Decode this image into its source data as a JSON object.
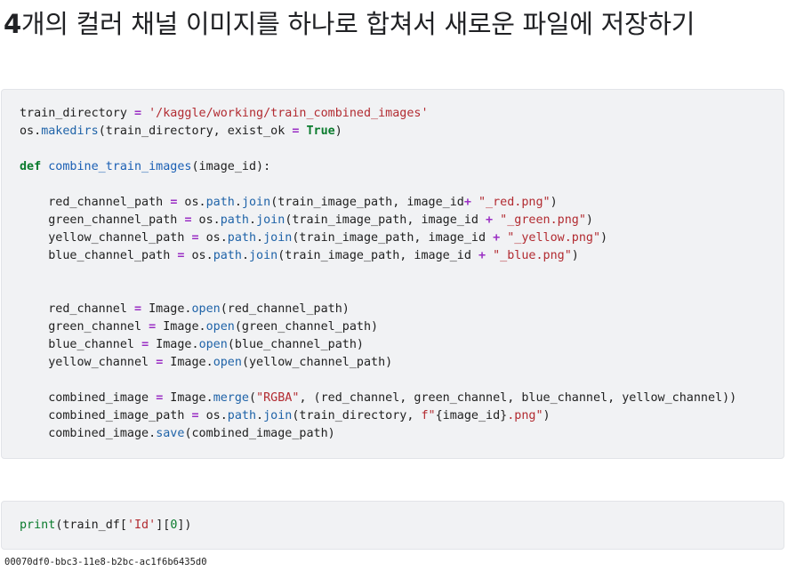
{
  "heading": {
    "number": "4",
    "text": "개의 컬러 채널 이미지를 하나로 합쳐서 새로운 파일에 저장하기"
  },
  "cell_1": {
    "lines": [
      "train_directory = '/kaggle/working/train_combined_images'",
      "os.makedirs(train_directory, exist_ok = True)",
      "",
      "def combine_train_images(image_id):",
      "",
      "    red_channel_path = os.path.join(train_image_path, image_id+ \"_red.png\")",
      "    green_channel_path = os.path.join(train_image_path, image_id + \"_green.png\")",
      "    yellow_channel_path = os.path.join(train_image_path, image_id + \"_yellow.png\")",
      "    blue_channel_path = os.path.join(train_image_path, image_id + \"_blue.png\")",
      "",
      "",
      "    red_channel = Image.open(red_channel_path)",
      "    green_channel = Image.open(green_channel_path)",
      "    blue_channel = Image.open(blue_channel_path)",
      "    yellow_channel = Image.open(yellow_channel_path)",
      "",
      "    combined_image = Image.merge(\"RGBA\", (red_channel, green_channel, blue_channel, yellow_channel))",
      "    combined_image_path = os.path.join(train_directory, f\"{image_id}.png\")",
      "    combined_image.save(combined_image_path)"
    ]
  },
  "cell_2": {
    "lines": [
      "print(train_df['Id'][0])"
    ]
  },
  "output": {
    "text": "00070df0-bbc3-11e8-b2bc-ac1f6b6435d0"
  },
  "colors": {
    "cell_background": "#f1f2f4",
    "string": "#b22b31",
    "keyword": "#0a7b2d",
    "function": "#1a5fb4",
    "operator": "#9a2fc4"
  }
}
